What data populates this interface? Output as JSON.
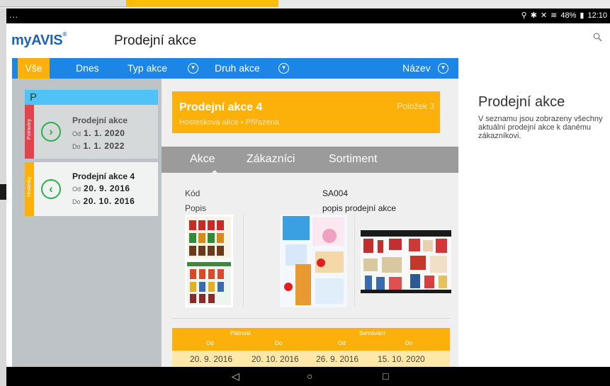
{
  "status": {
    "dots": "...",
    "battery": "48%",
    "time": "12:10"
  },
  "app": {
    "brand": "myAVIS",
    "brand_mark": "®",
    "title": "Prodejní akce"
  },
  "filters": {
    "all": "Vše",
    "today": "Dnes",
    "type": "Typ akce",
    "kind": "Druh akce",
    "sort": "Název"
  },
  "list": {
    "header": "P",
    "items": [
      {
        "tag": "Potraviny",
        "name": "Prodejní akce",
        "from_label": "Od",
        "from": "1. 1. 2020",
        "to_label": "Do",
        "to": "1. 1. 2022"
      },
      {
        "tag": "Hostesky",
        "name": "Prodejní akce 4",
        "from_label": "Od",
        "from": "20. 9. 2016",
        "to_label": "Do",
        "to": "20. 10. 2016"
      }
    ]
  },
  "detail": {
    "title": "Prodejní akce 4",
    "subtitle": "Hostesková akce • Přiřazená",
    "count": "Položek 3",
    "tabs": [
      "Akce",
      "Zákazníci",
      "Sortiment"
    ],
    "code_label": "Kód",
    "code_value": "SA004",
    "desc_label": "Popis",
    "desc_value": "popis prodejní akce",
    "dates": {
      "validity": "Platnost",
      "storage": "Sehrávání",
      "from": "Od",
      "to": "Do",
      "values": [
        "20. 9. 2016",
        "20. 10. 2016",
        "26. 9. 2016",
        "15. 10. 2020"
      ]
    }
  },
  "info": {
    "title": "Prodejní akce",
    "text": "V seznamu jsou zobrazeny všechny aktuální prodejní akce k danému zákazníkovi."
  },
  "colors": {
    "accent": "#1c86e6",
    "orange": "#fbb10a",
    "green": "#2bb04a",
    "red": "#e0454f"
  }
}
